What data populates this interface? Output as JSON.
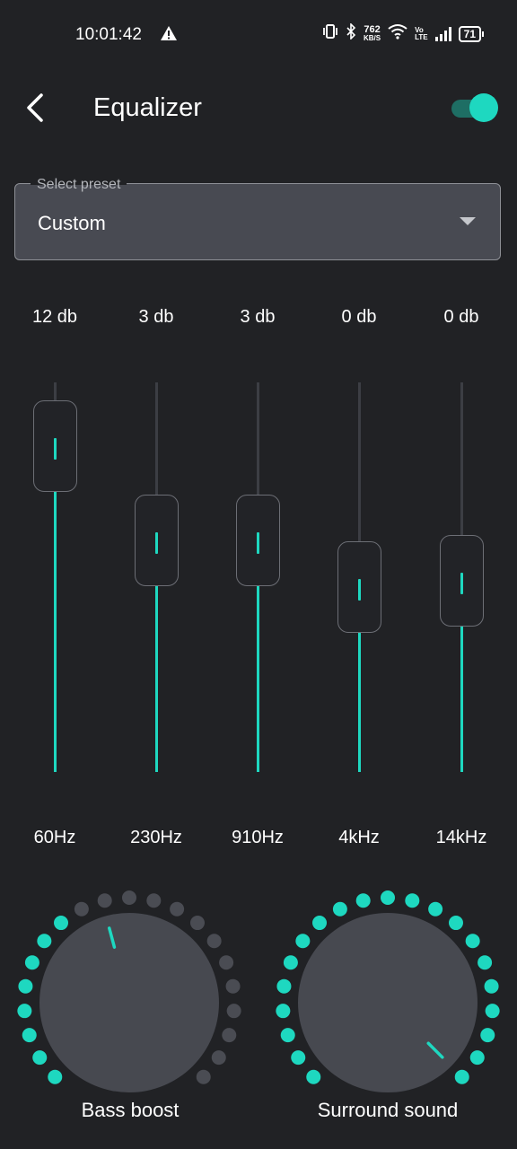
{
  "status_bar": {
    "time": "10:01:42",
    "alert_icon": "warning-triangle-icon",
    "net_speed_value": "762",
    "net_speed_unit": "KB/S",
    "volte_top": "Vo",
    "volte_bottom": "LTE",
    "battery": "71"
  },
  "header": {
    "title": "Equalizer",
    "toggle_on": true
  },
  "preset": {
    "label": "Select preset",
    "value": "Custom"
  },
  "bands": [
    {
      "db_label": "12 db",
      "freq_label": "60Hz",
      "level": 0.9
    },
    {
      "db_label": "3 db",
      "freq_label": "230Hz",
      "level": 0.6
    },
    {
      "db_label": "3 db",
      "freq_label": "910Hz",
      "level": 0.6
    },
    {
      "db_label": "0 db",
      "freq_label": "4kHz",
      "level": 0.45
    },
    {
      "db_label": "0 db",
      "freq_label": "14kHz",
      "level": 0.47
    }
  ],
  "knobs": [
    {
      "label": "Bass boost",
      "active_dots": 8,
      "total_dots": 21
    },
    {
      "label": "Surround sound",
      "active_dots": 21,
      "total_dots": 21
    }
  ],
  "colors": {
    "accent": "#1ed8c0",
    "background": "#212225",
    "inactive_dot": "#4a4c53",
    "knob_fill": "#474950"
  }
}
